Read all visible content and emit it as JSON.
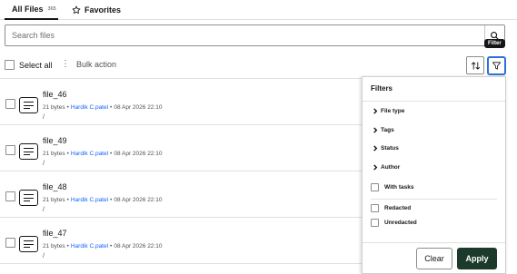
{
  "tabs": [
    {
      "label": "All Files",
      "count": "365",
      "active": true
    },
    {
      "label": "Favorites",
      "icon": "star-icon",
      "active": false
    }
  ],
  "search": {
    "placeholder": "Search files",
    "value": ""
  },
  "tooltip": "Filter",
  "toolbar": {
    "select_all_label": "Select all",
    "bulk_action_label": "Bulk action",
    "bulk_icon": "⋮"
  },
  "files": [
    {
      "name": "file_46",
      "size": "21 bytes",
      "author": "Hardik C.patel",
      "date": "08 Apr 2026 22:10",
      "path": "/"
    },
    {
      "name": "file_49",
      "size": "21 bytes",
      "author": "Hardik C.patel",
      "date": "08 Apr 2026 22:10",
      "path": "/"
    },
    {
      "name": "file_48",
      "size": "21 bytes",
      "author": "Hardik C.patel",
      "date": "08 Apr 2026 22:10",
      "path": "/"
    },
    {
      "name": "file_47",
      "size": "21 bytes",
      "author": "Hardik C.patel",
      "date": "08 Apr 2026 22:10",
      "path": "/"
    }
  ],
  "meta_separator": "•",
  "filters": {
    "title": "Filters",
    "sections": [
      "File type",
      "Tags",
      "Status",
      "Author"
    ],
    "options": [
      "With tasks",
      "Redacted",
      "Unredacted"
    ],
    "clear_label": "Clear",
    "apply_label": "Apply"
  },
  "colors": {
    "accent_link": "#0f62fe",
    "apply_button": "#1c3a2c",
    "filter_focus": "#2f6fd6"
  }
}
